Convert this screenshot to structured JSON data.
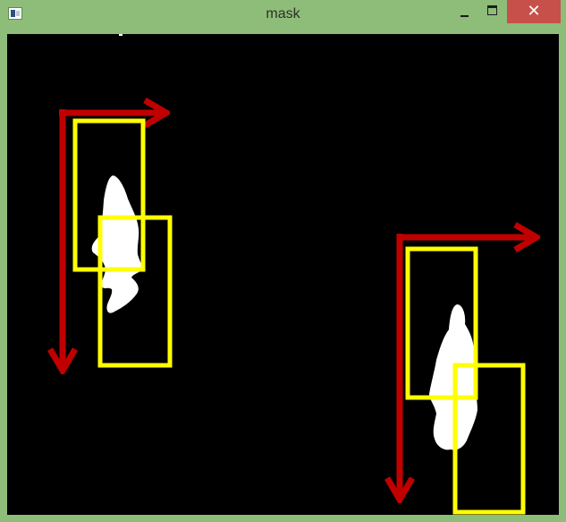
{
  "window": {
    "title": "mask",
    "minimize_label": "",
    "maximize_label": "",
    "close_glyph": "✕"
  },
  "icons": {
    "app": "opencv-window-icon",
    "minimize": "minimize-icon",
    "maximize": "maximize-icon",
    "close": "close-icon"
  },
  "colors": {
    "title_bar": "#8dbd78",
    "close_button": "#c7504a",
    "canvas_background": "#000000",
    "foreground_blob": "#ffffff",
    "bounding_box": "#ffff00",
    "direction_arrow": "#c00000"
  }
}
